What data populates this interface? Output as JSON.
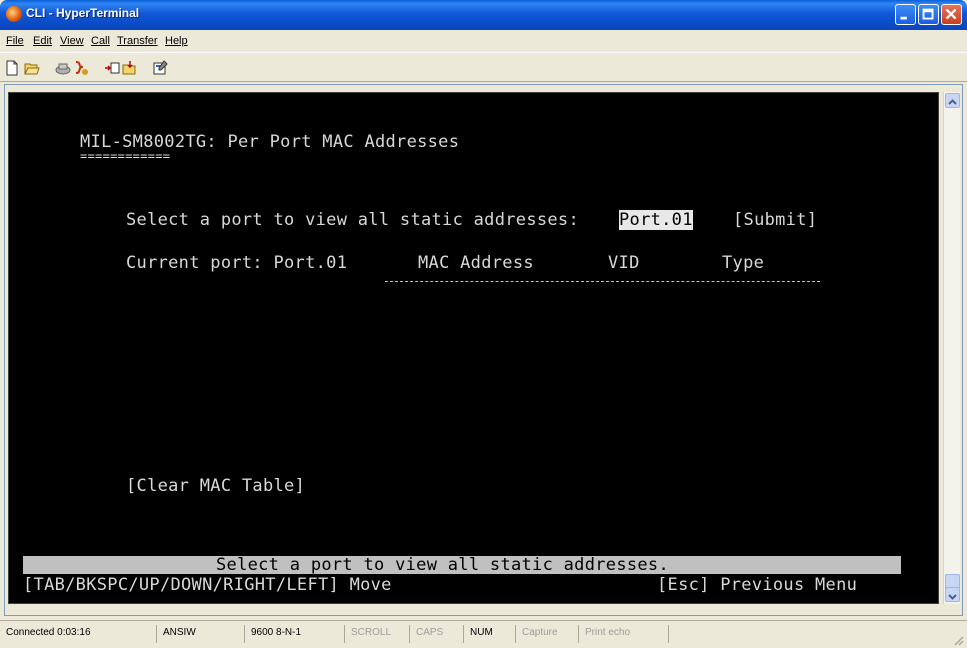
{
  "window": {
    "title": "CLI - HyperTerminal"
  },
  "menu": [
    "File",
    "Edit",
    "View",
    "Call",
    "Transfer",
    "Help"
  ],
  "toolbar_icons": [
    "new-icon",
    "open-icon",
    "disconnect-icon",
    "dial-icon",
    "send-icon",
    "receive-icon",
    "properties-icon"
  ],
  "terminal": {
    "header": "MIL-SM8002TG: Per Port MAC Addresses",
    "underline": "============",
    "select_prompt": "Select a port to view all static addresses:",
    "selected_port": "Port.01",
    "submit": "[Submit]",
    "current_port_label": "Current port: Port.01",
    "columns": [
      "MAC Address",
      "VID",
      "Type"
    ],
    "clear_button": "[Clear MAC Table]",
    "help_line": "Select a port to view all static addresses.",
    "nav_help": "[TAB/BKSPC/UP/DOWN/RIGHT/LEFT] Move",
    "esc_help": "[Esc] Previous Menu"
  },
  "status": {
    "connected": "Connected 0:03:16",
    "emulation": "ANSIW",
    "settings": "9600 8-N-1",
    "scroll": "SCROLL",
    "caps": "CAPS",
    "num": "NUM",
    "capture": "Capture",
    "print_echo": "Print echo"
  },
  "colors": {
    "title_bar": "#0a4bc6",
    "terminal_bg": "#000000",
    "terminal_fg": "#d8d8d8",
    "highlight": "#c0c0c0"
  }
}
